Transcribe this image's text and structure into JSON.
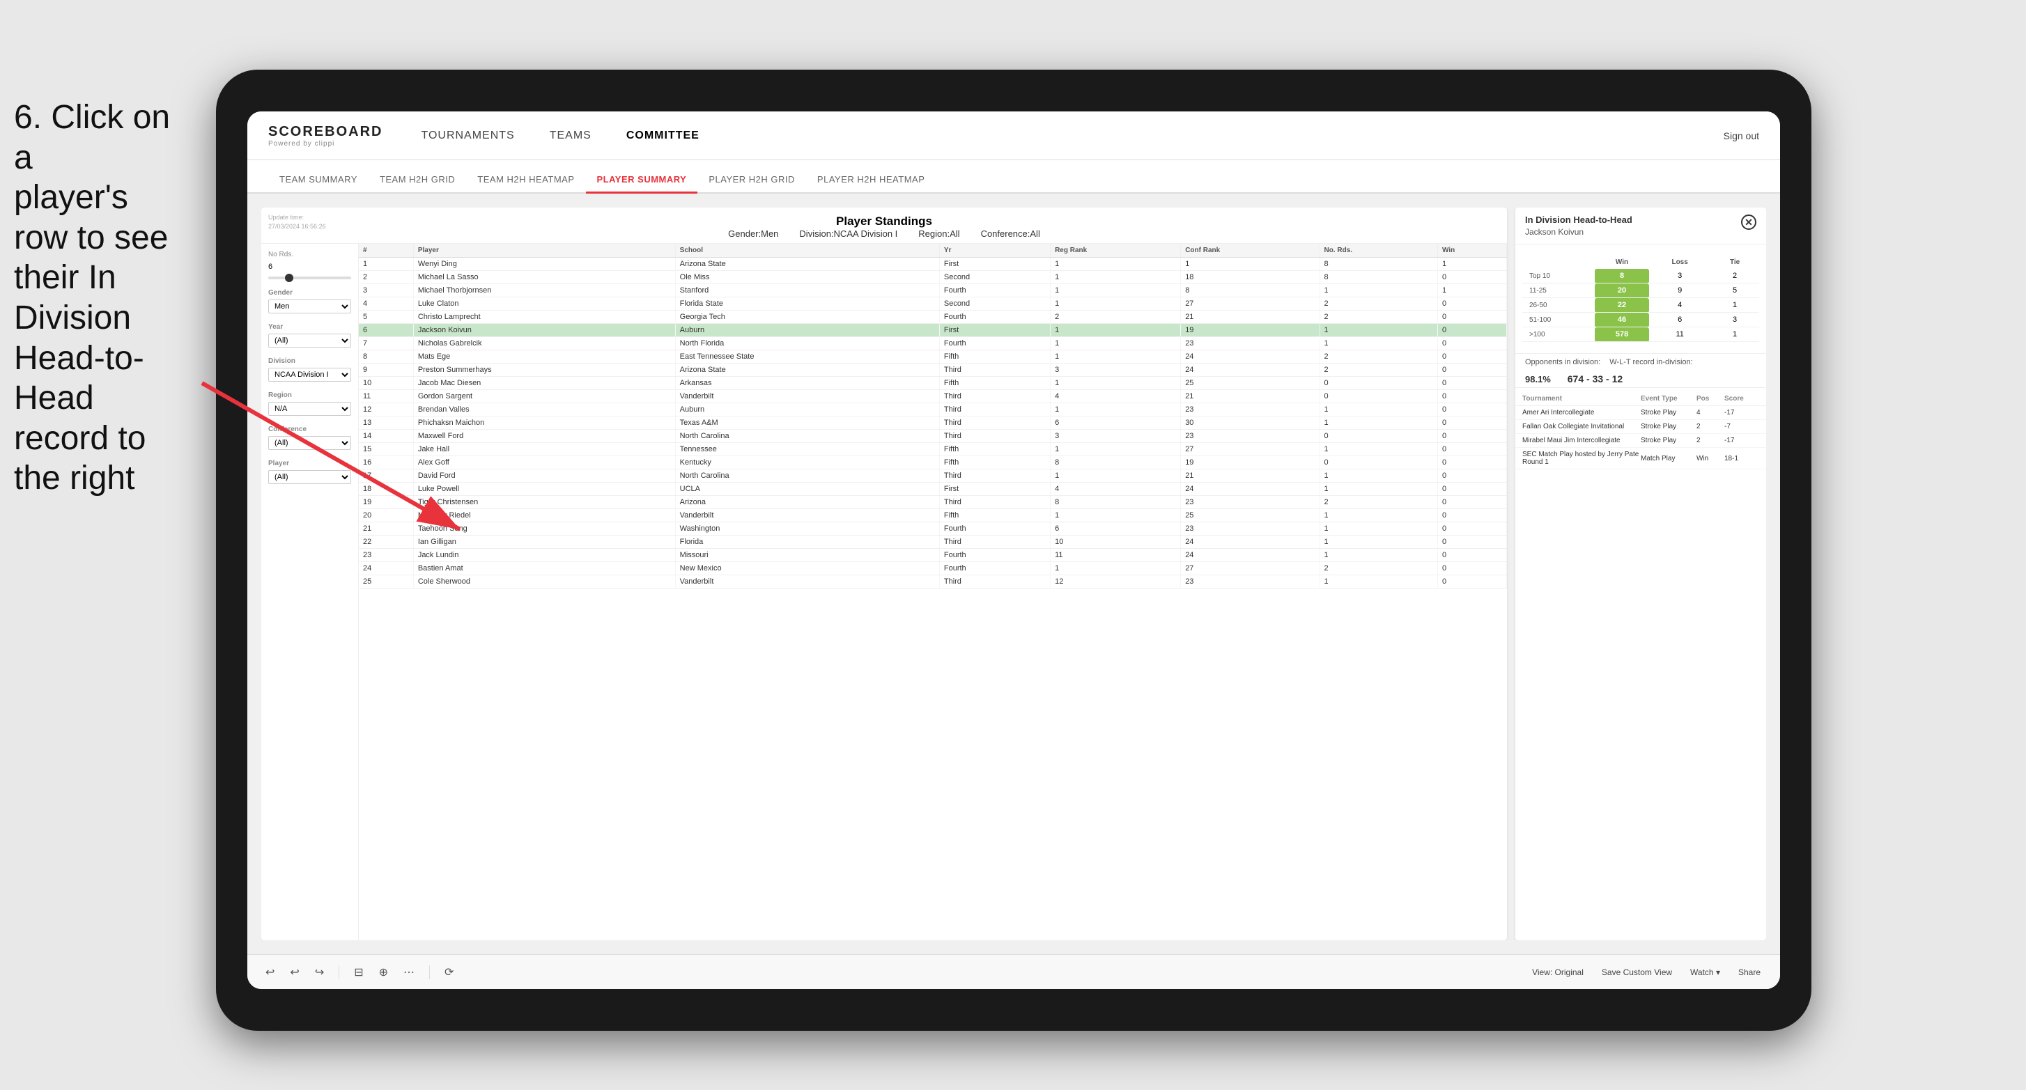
{
  "instruction": {
    "line1": "6. Click on a",
    "line2": "player's row to see",
    "line3": "their In Division",
    "line4": "Head-to-Head",
    "line5": "record to the right"
  },
  "header": {
    "logo": "SCOREBOARD",
    "powered": "Powered by clippi",
    "nav": [
      "TOURNAMENTS",
      "TEAMS",
      "COMMITTEE"
    ],
    "sign_out": "Sign out"
  },
  "sub_nav": {
    "items": [
      "TEAM SUMMARY",
      "TEAM H2H GRID",
      "TEAM H2H HEATMAP",
      "PLAYER SUMMARY",
      "PLAYER H2H GRID",
      "PLAYER H2H HEATMAP"
    ],
    "active": "PLAYER SUMMARY"
  },
  "dashboard": {
    "title": "Player Standings",
    "update_label": "Update time:",
    "update_time": "27/03/2024 16:56:26",
    "filters": {
      "gender": "Men",
      "division": "NCAA Division I",
      "region": "All",
      "conference": "All"
    },
    "sidebar_filters": {
      "no_rds_label": "No Rds.",
      "no_rds_value": "6",
      "gender_label": "Gender",
      "gender_value": "Men",
      "year_label": "Year",
      "year_value": "(All)",
      "division_label": "Division",
      "division_value": "NCAA Division I",
      "region_label": "Region",
      "region_value": "N/A",
      "conference_label": "Conference",
      "conference_value": "(All)",
      "player_label": "Player",
      "player_value": "(All)"
    },
    "table_headers": [
      "#",
      "Player",
      "School",
      "Yr",
      "Reg Rank",
      "Conf Rank",
      "No. Rds.",
      "Win"
    ],
    "rows": [
      {
        "num": 1,
        "player": "Wenyi Ding",
        "school": "Arizona State",
        "yr": "First",
        "reg": 1,
        "conf": 1,
        "rds": 8,
        "win": 1
      },
      {
        "num": 2,
        "player": "Michael La Sasso",
        "school": "Ole Miss",
        "yr": "Second",
        "reg": 1,
        "conf": 18,
        "rds": 8,
        "win": 0
      },
      {
        "num": 3,
        "player": "Michael Thorbjornsen",
        "school": "Stanford",
        "yr": "Fourth",
        "reg": 1,
        "conf": 8,
        "rds": 1,
        "win": 1
      },
      {
        "num": 4,
        "player": "Luke Claton",
        "school": "Florida State",
        "yr": "Second",
        "reg": 1,
        "conf": 27,
        "rds": 2,
        "win": 0
      },
      {
        "num": 5,
        "player": "Christo Lamprecht",
        "school": "Georgia Tech",
        "yr": "Fourth",
        "reg": 2,
        "conf": 21,
        "rds": 2,
        "win": 0
      },
      {
        "num": 6,
        "player": "Jackson Koivun",
        "school": "Auburn",
        "yr": "First",
        "reg": 1,
        "conf": 19,
        "rds": 1,
        "win": 0,
        "selected": true
      },
      {
        "num": 7,
        "player": "Nicholas Gabrelcik",
        "school": "North Florida",
        "yr": "Fourth",
        "reg": 1,
        "conf": 23,
        "rds": 1,
        "win": 0
      },
      {
        "num": 8,
        "player": "Mats Ege",
        "school": "East Tennessee State",
        "yr": "Fifth",
        "reg": 1,
        "conf": 24,
        "rds": 2,
        "win": 0
      },
      {
        "num": 9,
        "player": "Preston Summerhays",
        "school": "Arizona State",
        "yr": "Third",
        "reg": 3,
        "conf": 24,
        "rds": 2,
        "win": 0
      },
      {
        "num": 10,
        "player": "Jacob Mac Diesen",
        "school": "Arkansas",
        "yr": "Fifth",
        "reg": 1,
        "conf": 25,
        "rds": 0,
        "win": 0
      },
      {
        "num": 11,
        "player": "Gordon Sargent",
        "school": "Vanderbilt",
        "yr": "Third",
        "reg": 4,
        "conf": 21,
        "rds": 0,
        "win": 0
      },
      {
        "num": 12,
        "player": "Brendan Valles",
        "school": "Auburn",
        "yr": "Third",
        "reg": 1,
        "conf": 23,
        "rds": 1,
        "win": 0
      },
      {
        "num": 13,
        "player": "Phichaksn Maichon",
        "school": "Texas A&M",
        "yr": "Third",
        "reg": 6,
        "conf": 30,
        "rds": 1,
        "win": 0
      },
      {
        "num": 14,
        "player": "Maxwell Ford",
        "school": "North Carolina",
        "yr": "Third",
        "reg": 3,
        "conf": 23,
        "rds": 0,
        "win": 0
      },
      {
        "num": 15,
        "player": "Jake Hall",
        "school": "Tennessee",
        "yr": "Fifth",
        "reg": 1,
        "conf": 27,
        "rds": 1,
        "win": 0
      },
      {
        "num": 16,
        "player": "Alex Goff",
        "school": "Kentucky",
        "yr": "Fifth",
        "reg": 8,
        "conf": 19,
        "rds": 0,
        "win": 0
      },
      {
        "num": 17,
        "player": "David Ford",
        "school": "North Carolina",
        "yr": "Third",
        "reg": 1,
        "conf": 21,
        "rds": 1,
        "win": 0
      },
      {
        "num": 18,
        "player": "Luke Powell",
        "school": "UCLA",
        "yr": "First",
        "reg": 4,
        "conf": 24,
        "rds": 1,
        "win": 0
      },
      {
        "num": 19,
        "player": "Tiger Christensen",
        "school": "Arizona",
        "yr": "Third",
        "reg": 8,
        "conf": 23,
        "rds": 2,
        "win": 0
      },
      {
        "num": 20,
        "player": "Matthew Riedel",
        "school": "Vanderbilt",
        "yr": "Fifth",
        "reg": 1,
        "conf": 25,
        "rds": 1,
        "win": 0
      },
      {
        "num": 21,
        "player": "Taehoon Song",
        "school": "Washington",
        "yr": "Fourth",
        "reg": 6,
        "conf": 23,
        "rds": 1,
        "win": 0
      },
      {
        "num": 22,
        "player": "Ian Gilligan",
        "school": "Florida",
        "yr": "Third",
        "reg": 10,
        "conf": 24,
        "rds": 1,
        "win": 0
      },
      {
        "num": 23,
        "player": "Jack Lundin",
        "school": "Missouri",
        "yr": "Fourth",
        "reg": 11,
        "conf": 24,
        "rds": 1,
        "win": 0
      },
      {
        "num": 24,
        "player": "Bastien Amat",
        "school": "New Mexico",
        "yr": "Fourth",
        "reg": 1,
        "conf": 27,
        "rds": 2,
        "win": 0
      },
      {
        "num": 25,
        "player": "Cole Sherwood",
        "school": "Vanderbilt",
        "yr": "Third",
        "reg": 12,
        "conf": 23,
        "rds": 1,
        "win": 0
      }
    ]
  },
  "h2h": {
    "title": "In Division Head-to-Head",
    "player": "Jackson Koivun",
    "table_headers": [
      "Win",
      "Loss",
      "Tie"
    ],
    "rows": [
      {
        "rank": "Top 10",
        "win": 8,
        "loss": 3,
        "tie": 2,
        "win_green": true
      },
      {
        "rank": "11-25",
        "win": 20,
        "loss": 9,
        "tie": 5,
        "win_green": true
      },
      {
        "rank": "26-50",
        "win": 22,
        "loss": 4,
        "tie": 1,
        "win_green": true
      },
      {
        "rank": "51-100",
        "win": 46,
        "loss": 6,
        "tie": 3,
        "win_green": true
      },
      {
        "rank": ">100",
        "win": 578,
        "loss": 11,
        "tie": 1,
        "win_green": true
      }
    ],
    "opponents_label": "Opponents in division:",
    "wl_label": "W-L-T record in-division:",
    "opponents_pct": "98.1%",
    "wl_record": "674 - 33 - 12",
    "tournaments_headers": [
      "Tournament",
      "Event Type",
      "Pos",
      "Score"
    ],
    "tournaments": [
      {
        "name": "Amer Ari Intercollegiate",
        "type": "Stroke Play",
        "pos": 4,
        "score": "-17"
      },
      {
        "name": "Fallan Oak Collegiate Invitational",
        "type": "Stroke Play",
        "pos": 2,
        "score": "-7"
      },
      {
        "name": "Mirabel Maui Jim Intercollegiate",
        "type": "Stroke Play",
        "pos": 2,
        "score": "-17"
      },
      {
        "name": "SEC Match Play hosted by Jerry Pate Round 1",
        "type": "Match Play",
        "pos": "Win",
        "score": "18-1"
      }
    ]
  },
  "toolbar": {
    "view_original": "View: Original",
    "save_custom": "Save Custom View",
    "watch": "Watch ▾",
    "share": "Share"
  }
}
